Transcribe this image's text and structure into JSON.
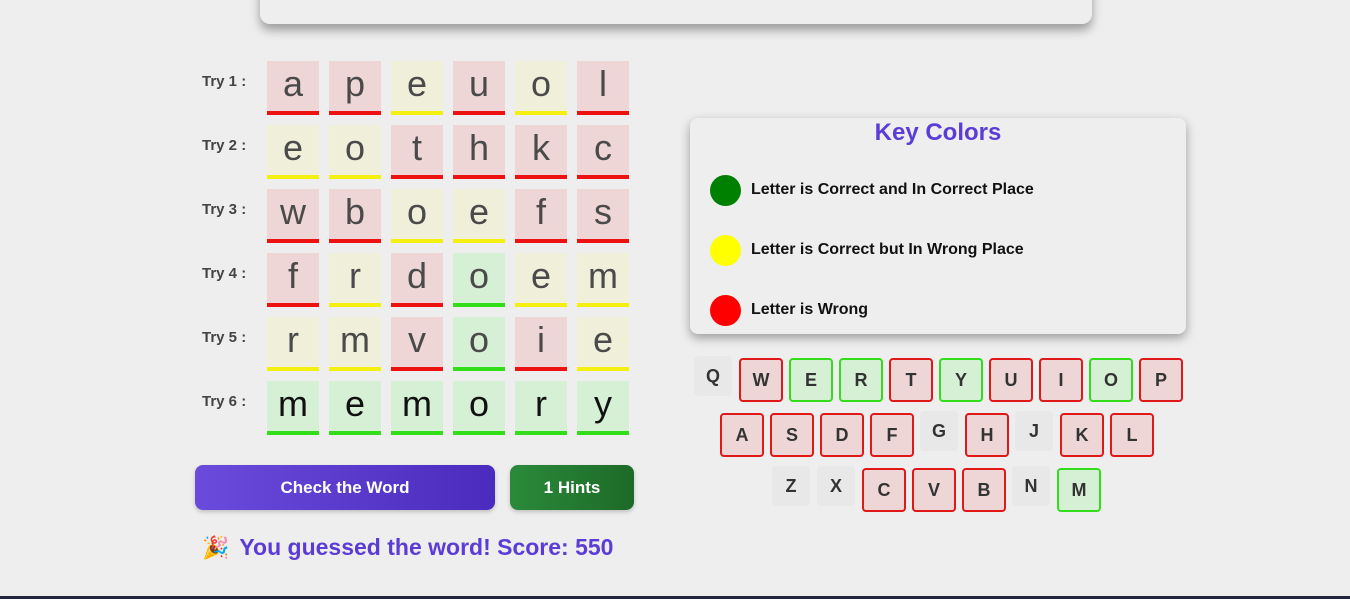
{
  "board": {
    "rows": [
      {
        "label": "Try 1 :",
        "tiles": [
          {
            "letter": "a",
            "state": "wrong"
          },
          {
            "letter": "p",
            "state": "wrong"
          },
          {
            "letter": "e",
            "state": "misplaced"
          },
          {
            "letter": "u",
            "state": "wrong"
          },
          {
            "letter": "o",
            "state": "misplaced"
          },
          {
            "letter": "l",
            "state": "wrong"
          }
        ]
      },
      {
        "label": "Try 2 :",
        "tiles": [
          {
            "letter": "e",
            "state": "misplaced"
          },
          {
            "letter": "o",
            "state": "misplaced"
          },
          {
            "letter": "t",
            "state": "wrong"
          },
          {
            "letter": "h",
            "state": "wrong"
          },
          {
            "letter": "k",
            "state": "wrong"
          },
          {
            "letter": "c",
            "state": "wrong"
          }
        ]
      },
      {
        "label": "Try 3 :",
        "tiles": [
          {
            "letter": "w",
            "state": "wrong"
          },
          {
            "letter": "b",
            "state": "wrong"
          },
          {
            "letter": "o",
            "state": "misplaced"
          },
          {
            "letter": "e",
            "state": "misplaced"
          },
          {
            "letter": "f",
            "state": "wrong"
          },
          {
            "letter": "s",
            "state": "wrong"
          }
        ]
      },
      {
        "label": "Try 4 :",
        "tiles": [
          {
            "letter": "f",
            "state": "wrong"
          },
          {
            "letter": "r",
            "state": "misplaced"
          },
          {
            "letter": "d",
            "state": "wrong"
          },
          {
            "letter": "o",
            "state": "correct"
          },
          {
            "letter": "e",
            "state": "misplaced"
          },
          {
            "letter": "m",
            "state": "misplaced"
          }
        ]
      },
      {
        "label": "Try 5 :",
        "tiles": [
          {
            "letter": "r",
            "state": "misplaced"
          },
          {
            "letter": "m",
            "state": "misplaced"
          },
          {
            "letter": "v",
            "state": "wrong"
          },
          {
            "letter": "o",
            "state": "correct"
          },
          {
            "letter": "i",
            "state": "wrong"
          },
          {
            "letter": "e",
            "state": "misplaced"
          }
        ]
      },
      {
        "label": "Try 6 :",
        "tiles": [
          {
            "letter": "m",
            "state": "correct"
          },
          {
            "letter": "e",
            "state": "correct"
          },
          {
            "letter": "m",
            "state": "correct"
          },
          {
            "letter": "o",
            "state": "correct"
          },
          {
            "letter": "r",
            "state": "correct"
          },
          {
            "letter": "y",
            "state": "correct"
          }
        ]
      }
    ]
  },
  "buttons": {
    "check_label": "Check the Word",
    "hints_label": "1 Hints"
  },
  "result": {
    "icon": "party-popper-icon",
    "text": "You guessed the word! Score: 550"
  },
  "legend": {
    "title": "Key Colors",
    "items": [
      {
        "color": "#008000",
        "text": "Letter is Correct and In Correct Place"
      },
      {
        "color": "#ffff00",
        "text": "Letter is Correct but In Wrong Place"
      },
      {
        "color": "#ff0000",
        "text": "Letter is Wrong"
      }
    ]
  },
  "keyboard": {
    "rows": [
      [
        {
          "k": "Q",
          "s": "unused"
        },
        {
          "k": "W",
          "s": "wrong"
        },
        {
          "k": "E",
          "s": "correct"
        },
        {
          "k": "R",
          "s": "correct"
        },
        {
          "k": "T",
          "s": "wrong"
        },
        {
          "k": "Y",
          "s": "correct"
        },
        {
          "k": "U",
          "s": "wrong"
        },
        {
          "k": "I",
          "s": "wrong"
        },
        {
          "k": "O",
          "s": "correct"
        },
        {
          "k": "P",
          "s": "wrong"
        }
      ],
      [
        {
          "k": "A",
          "s": "wrong"
        },
        {
          "k": "S",
          "s": "wrong"
        },
        {
          "k": "D",
          "s": "wrong"
        },
        {
          "k": "F",
          "s": "wrong"
        },
        {
          "k": "G",
          "s": "unused"
        },
        {
          "k": "H",
          "s": "wrong"
        },
        {
          "k": "J",
          "s": "unused"
        },
        {
          "k": "K",
          "s": "wrong"
        },
        {
          "k": "L",
          "s": "wrong"
        }
      ],
      [
        {
          "k": "Z",
          "s": "unused"
        },
        {
          "k": "X",
          "s": "unused"
        },
        {
          "k": "C",
          "s": "wrong"
        },
        {
          "k": "V",
          "s": "wrong"
        },
        {
          "k": "B",
          "s": "wrong"
        },
        {
          "k": "N",
          "s": "unused"
        },
        {
          "k": "M",
          "s": "correct"
        }
      ]
    ]
  }
}
